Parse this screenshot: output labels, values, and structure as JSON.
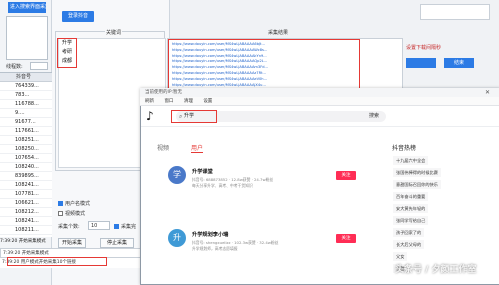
{
  "left": {
    "search_bar": "进入搜索界面采集",
    "interval_label": "线程数:",
    "table_header": [
      "",
      "抖音号"
    ],
    "rows": [
      {
        "n": "",
        "v": "764339..."
      },
      {
        "n": "",
        "v": "783..."
      },
      {
        "n": "",
        "v": "116788..."
      },
      {
        "n": "",
        "v": "9...."
      },
      {
        "n": "",
        "v": "91677..."
      },
      {
        "n": "",
        "v": "117661..."
      },
      {
        "n": "",
        "v": "108251..."
      },
      {
        "n": "",
        "v": "108250..."
      },
      {
        "n": "",
        "v": "107654..."
      },
      {
        "n": "",
        "v": "108240..."
      },
      {
        "n": "",
        "v": "839895..."
      },
      {
        "n": "",
        "v": "108241..."
      },
      {
        "n": "",
        "v": "107781..."
      },
      {
        "n": "",
        "v": "106621..."
      },
      {
        "n": "",
        "v": "108212..."
      },
      {
        "n": "",
        "v": "108241..."
      },
      {
        "n": "",
        "v": "108211..."
      }
    ],
    "log": "7:39:20 开始采集模式"
  },
  "mid": {
    "login_button": "登录抖音",
    "keyword_group_title": "关键词",
    "keywords": [
      "升学",
      "考研",
      "成都"
    ],
    "opt_user": "用户名模式",
    "opt_video": "视频模式",
    "count_label": "采集个数:",
    "count_value": "10",
    "opt_save": "采集完",
    "start_button": "开始采集",
    "stop_button": "停止采集",
    "log_line1": "7:39:20 开始采集模式",
    "log_line2": "7:39:20 用户模式开始采集10个链接"
  },
  "result": {
    "title": "采集结果",
    "urls": [
      "https://www.douyin.com/user/MS4wLjABAAAA6bJt...",
      "https://www.douyin.com/user/MS4wLjABAAAAWc8s...",
      "https://www.douyin.com/user/MS4wLjABAAAAkYn9...",
      "https://www.douyin.com/user/MS4wLjABAAAAQp2L...",
      "https://www.douyin.com/user/MS4wLjABAAAAm3Fd...",
      "https://www.douyin.com/user/MS4wLjABAAAAz7Rt...",
      "https://www.douyin.com/user/MS4wLjABAAAAeV0h...",
      "https://www.douyin.com/user/MS4wLjABAAAAjX4u..."
    ],
    "info": "设置下载间隔秒",
    "btn1": "",
    "btn2": "结束"
  },
  "browser": {
    "title": "当前使用的IP:暂无",
    "menu": [
      "刷新",
      "窗口",
      "清理",
      "设置"
    ],
    "search_value": "升学",
    "search_button": "搜索",
    "tab_video": "视频",
    "tab_user": "用户",
    "hot_title": "抖音热榜",
    "hot_items": [
      "十九届六中全会",
      "张国伟捧得的时候比赛",
      "意甜国际召回你的快乐",
      "百年奋斗的重要",
      "安大黄先年轻的",
      "张同学写给自己",
      "孩子回家了的",
      "长大后父母的",
      "父女",
      "花甜"
    ],
    "users": [
      {
        "avatar": "学",
        "name": "升学课堂",
        "meta": "抖音号: 688873852 · 12.8w获赞 · 24.7w粉丝",
        "desc": "每天分享升学、高考、中考干货知识",
        "follow": "关注"
      },
      {
        "avatar": "升",
        "name": "升学规划李小瑞",
        "meta": "抖音号: shengxuelizz · 102.3w获赞 · 32.4w粉丝",
        "desc": "升学规划师，高考志愿填报",
        "follow": "关注"
      }
    ],
    "watermark": "头条号 / 夕颜工作室"
  }
}
